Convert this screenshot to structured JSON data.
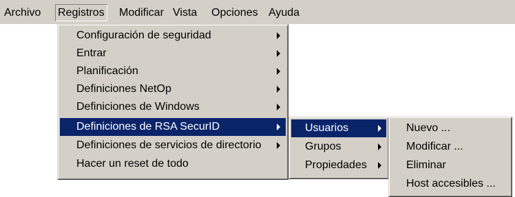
{
  "menubar": {
    "items": [
      "Archivo",
      "Registros",
      "Modificar",
      "Vista",
      "Opciones",
      "Ayuda"
    ]
  },
  "registros_menu": {
    "items": [
      "Configuración de seguridad",
      "Entrar",
      "Planificación",
      "Definiciones NetOp",
      "Definiciones de Windows",
      "Definiciones de RSA SecurID",
      "Definiciones de servicios de directorio",
      "Hacer un reset de todo"
    ]
  },
  "rsa_menu": {
    "items": [
      "Usuarios",
      "Grupos",
      "Propiedades"
    ]
  },
  "usuarios_menu": {
    "items": [
      "Nuevo ...",
      "Modificar ...",
      "Eliminar",
      "Host accesibles ..."
    ]
  },
  "colors": {
    "menu_bg": "#d4d0c8",
    "highlight": "#0a246a",
    "highlight_text": "#ffffff"
  }
}
